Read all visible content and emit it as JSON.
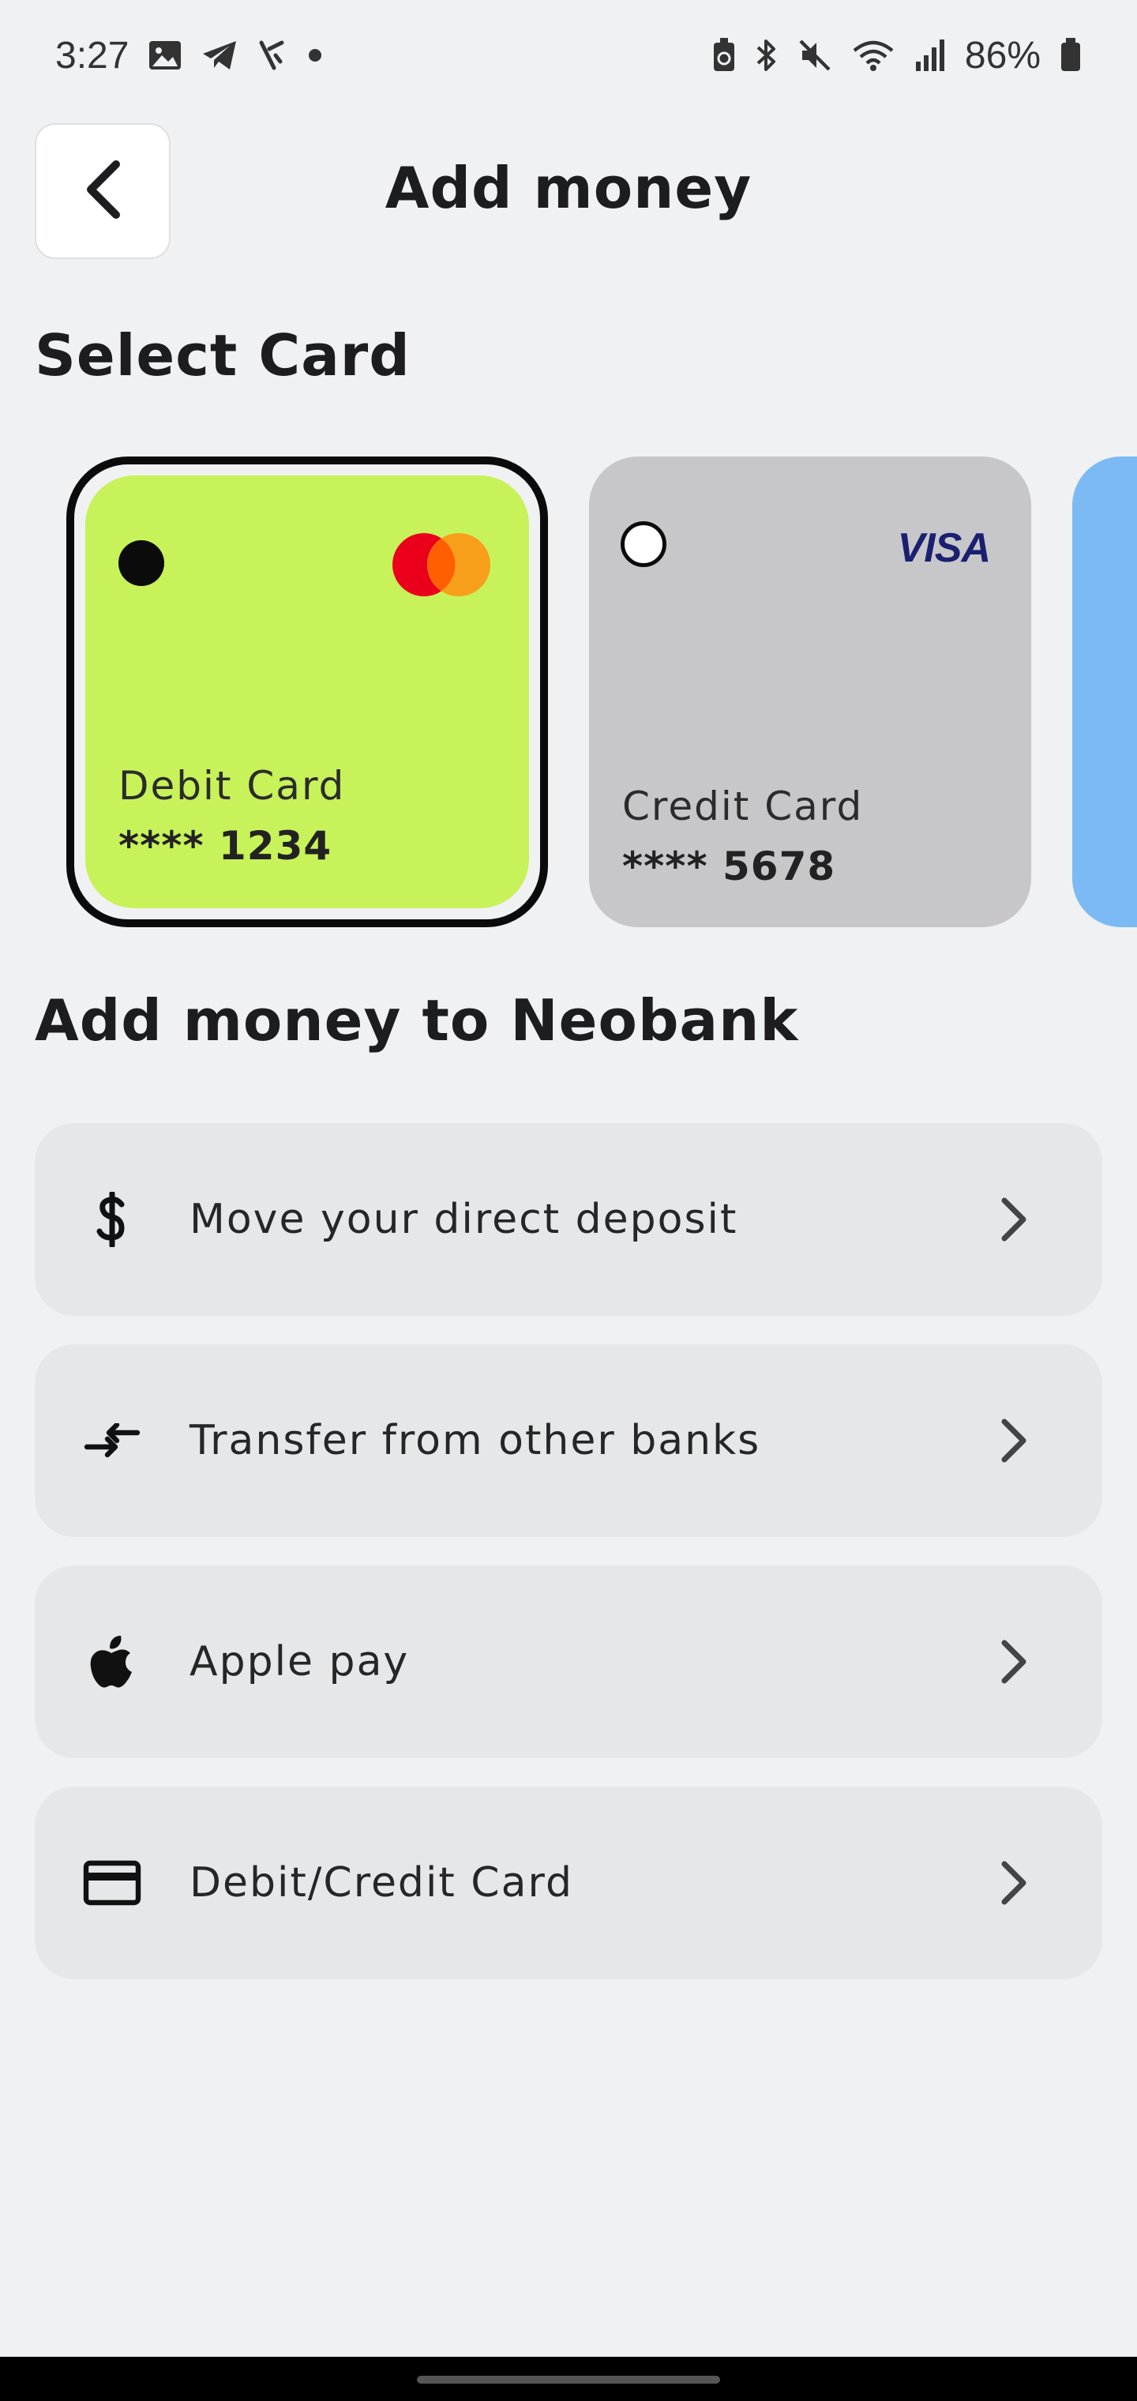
{
  "status_bar": {
    "time": "3:27",
    "battery": "86%"
  },
  "header": {
    "title": "Add money"
  },
  "select_card": {
    "title": "Select Card",
    "cards": [
      {
        "type": "Debit Card",
        "number": "**** 1234",
        "brand": "mastercard",
        "selected": true,
        "color": "#c8f25a"
      },
      {
        "type": "Credit Card",
        "number": "**** 5678",
        "brand": "VISA",
        "selected": false,
        "color": "#c7c7c9"
      },
      {
        "type": "",
        "number": "",
        "brand": "",
        "selected": false,
        "color": "#7bbaf5"
      }
    ]
  },
  "add_money": {
    "title": "Add money to Neobank",
    "options": [
      {
        "label": "Move your direct deposit",
        "icon": "dollar-icon"
      },
      {
        "label": "Transfer from other banks",
        "icon": "transfer-arrows-icon"
      },
      {
        "label": "Apple pay",
        "icon": "apple-icon"
      },
      {
        "label": "Debit/Credit Card",
        "icon": "credit-card-icon"
      }
    ]
  },
  "colors": {
    "background": "#f0f1f3",
    "accent_lime": "#c8f25a",
    "option_bg": "#e6e7e9"
  }
}
